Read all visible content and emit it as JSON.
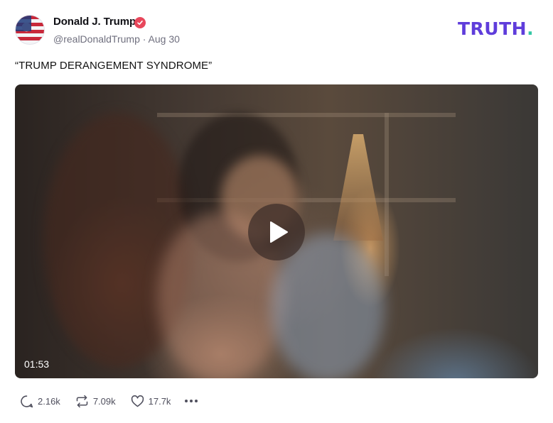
{
  "author": {
    "name": "Donald J. Trump",
    "handle": "@realDonaldTrump",
    "date": "Aug 30",
    "separator": "·",
    "verified": true,
    "verified_color": "#e8475b"
  },
  "brand": {
    "logo_text": "TRUTH",
    "logo_dot": ".",
    "logo_color": "#5f3ddb",
    "dot_color": "#34c7a5"
  },
  "post": {
    "text": "“TRUMP DERANGEMENT SYNDROME”"
  },
  "video": {
    "duration": "01:53",
    "play_icon": "play-icon"
  },
  "actions": {
    "replies": "2.16k",
    "retruths": "7.09k",
    "likes": "17.7k",
    "icons": [
      "reply-icon",
      "retruth-icon",
      "heart-icon",
      "more-icon"
    ]
  }
}
